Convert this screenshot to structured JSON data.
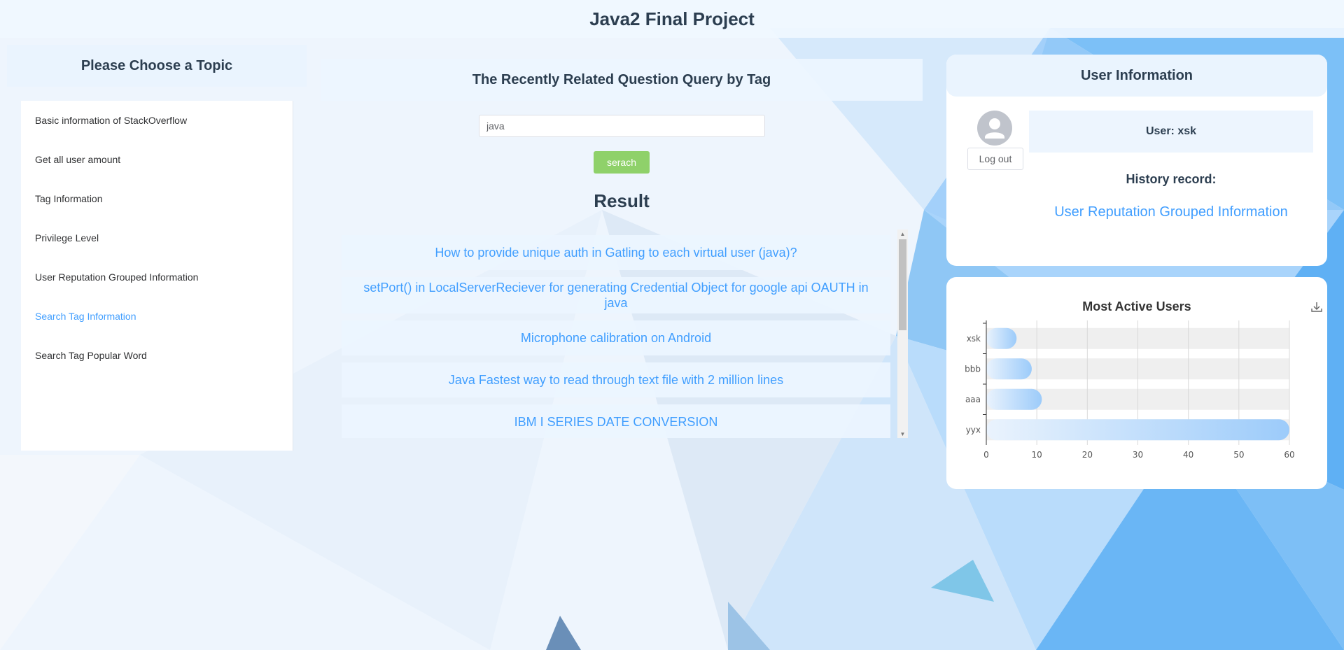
{
  "header": {
    "title": "Java2 Final Project"
  },
  "sidebar": {
    "title": "Please Choose a Topic",
    "items": [
      {
        "label": "Basic information of StackOverflow",
        "active": false
      },
      {
        "label": "Get all user amount",
        "active": false
      },
      {
        "label": "Tag Information",
        "active": false
      },
      {
        "label": "Privilege Level",
        "active": false
      },
      {
        "label": "User Reputation Grouped Information",
        "active": false
      },
      {
        "label": "Search Tag Information",
        "active": true
      },
      {
        "label": "Search Tag Popular Word",
        "active": false
      }
    ]
  },
  "main": {
    "title": "The Recently Related Question Query by Tag",
    "search": {
      "value": "java",
      "button_label": "serach"
    },
    "result_title": "Result",
    "results": [
      "How to provide unique auth in Gatling to each virtual user (java)?",
      "setPort() in LocalServerReciever for generating Credential Object for google api OAUTH in java",
      "Microphone calibration on Android",
      "Java Fastest way to read through text file with 2 million lines",
      "IBM I SERIES DATE CONVERSION"
    ]
  },
  "user_panel": {
    "title": "User Information",
    "logout_label": "Log out",
    "user_label": "User: xsk",
    "history_label": "History record:",
    "history_link": "User Reputation Grouped Information"
  },
  "chart_panel": {
    "title": "Most Active Users",
    "download_icon": "download-icon"
  },
  "chart_data": {
    "type": "bar",
    "orientation": "horizontal",
    "title": "Most Active Users",
    "categories": [
      "xsk",
      "bbb",
      "aaa",
      "yyx"
    ],
    "values": [
      6,
      9,
      11,
      60
    ],
    "xlim": [
      0,
      60
    ],
    "xticks": [
      0,
      10,
      20,
      30,
      40,
      50,
      60
    ],
    "grid": true,
    "colors": {
      "bar_start": "#eaf3fd",
      "bar_end": "#9ccbfa",
      "track": "#efefef"
    }
  },
  "colors": {
    "accent": "#409eff",
    "button_green": "#8fd16a",
    "panel_bg": "#eaf4fe"
  }
}
